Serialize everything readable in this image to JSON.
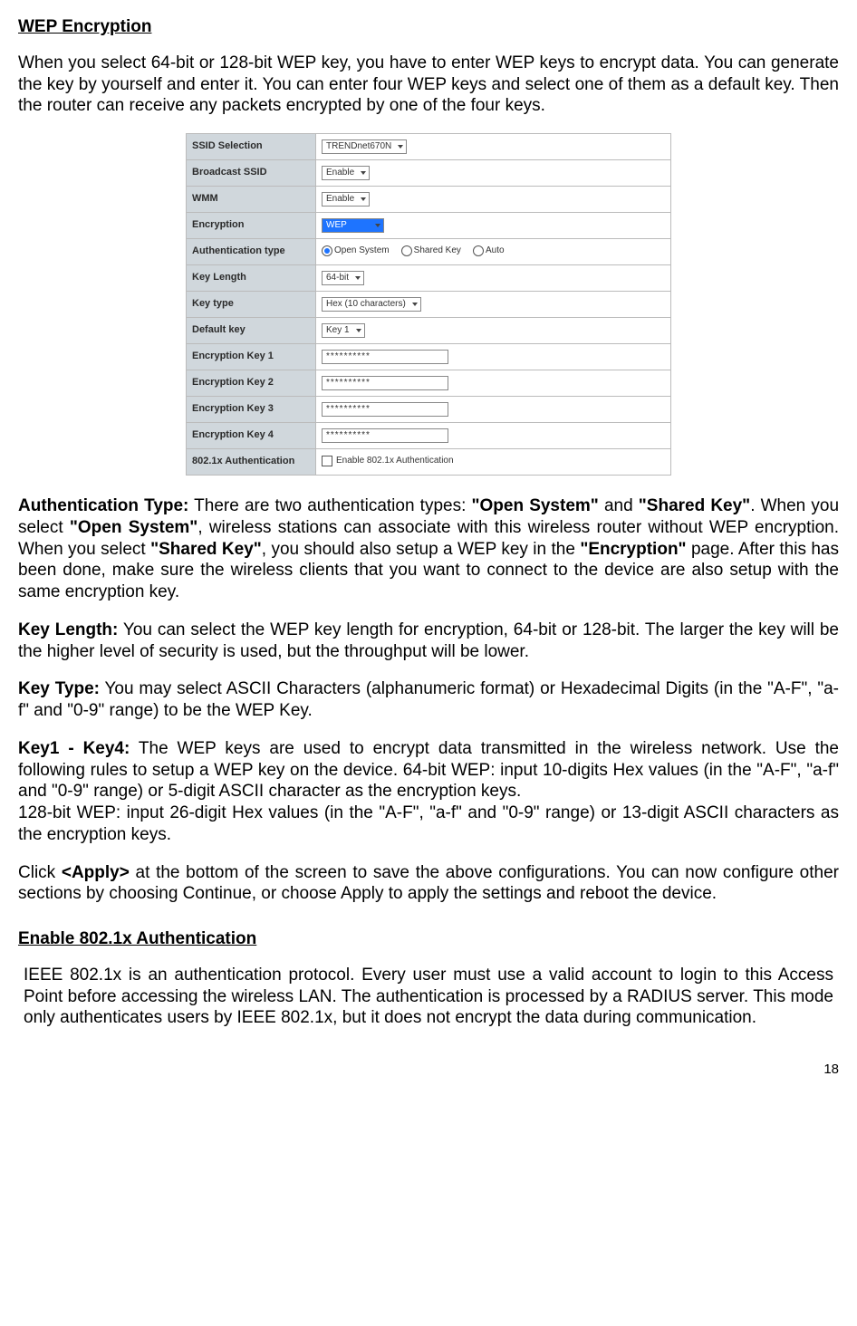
{
  "title1": "WEP Encryption",
  "intro": "When you select 64-bit or 128-bit WEP key, you have to enter WEP keys to encrypt data. You can generate the key by yourself and enter it. You can enter four WEP keys and select one of them as a default key. Then the router can receive any packets encrypted by one of the four keys.",
  "table": {
    "rows": [
      {
        "label": "SSID Selection",
        "type": "select",
        "value": "TRENDnet670N"
      },
      {
        "label": "Broadcast SSID",
        "type": "select",
        "value": "Enable"
      },
      {
        "label": "WMM",
        "type": "select",
        "value": "Enable"
      },
      {
        "label": "Encryption",
        "type": "select-highlight",
        "value": "WEP"
      },
      {
        "label": "Authentication type",
        "type": "radios",
        "options": [
          "Open System",
          "Shared Key",
          "Auto"
        ],
        "checked": 0
      },
      {
        "label": "Key Length",
        "type": "select",
        "value": "64-bit"
      },
      {
        "label": "Key type",
        "type": "select",
        "value": "Hex (10 characters)"
      },
      {
        "label": "Default key",
        "type": "select",
        "value": "Key 1"
      },
      {
        "label": "Encryption Key 1",
        "type": "text",
        "value": "**********"
      },
      {
        "label": "Encryption Key 2",
        "type": "text",
        "value": "**********"
      },
      {
        "label": "Encryption Key 3",
        "type": "text",
        "value": "**********"
      },
      {
        "label": "Encryption Key 4",
        "type": "text",
        "value": "**********"
      },
      {
        "label": "802.1x Authentication",
        "type": "checkbox",
        "value": "Enable 802.1x Authentication"
      }
    ]
  },
  "auth_type_label": "Authentication Type:",
  "auth_type_text1": " There are two authentication types: ",
  "auth_type_b1": "\"Open System\"",
  "auth_type_text2": " and ",
  "auth_type_b2": "\"Shared Key\"",
  "auth_type_text3": ". When you select ",
  "auth_type_b3": "\"Open System\"",
  "auth_type_text4": ", wireless stations can associate with this wireless router without WEP encryption. When you select ",
  "auth_type_b4": "\"Shared Key\"",
  "auth_type_text5": ", you should also setup a WEP key in the ",
  "auth_type_b5": "\"Encryption\"",
  "auth_type_text6": " page. After this has been done, make sure the wireless clients that you want to connect to the device are also setup with the same encryption key.",
  "key_length_label": "Key Length:",
  "key_length_text": " You can select the WEP key length for encryption, 64-bit or 128-bit. The larger the key will be the higher level of security is used, but the throughput will be lower.",
  "key_type_label": "Key Type:",
  "key_type_text": " You may select ASCII Characters (alphanumeric format) or Hexadecimal Digits (in the \"A-F\", \"a-f\" and \"0-9\" range) to be the WEP Key.",
  "key14_label": "Key1 - Key4:",
  "key14_text": " The WEP keys are used to encrypt data transmitted in the wireless network. Use the following rules to setup a WEP key on the device. 64-bit WEP: input 10-digits Hex values (in the \"A-F\", \"a-f\" and \"0-9\" range) or 5-digit ASCII character as the encryption keys.",
  "key128_text": "128-bit WEP: input 26-digit Hex values (in the \"A-F\", \"a-f\" and \"0-9\" range) or 13-digit ASCII characters as the encryption keys.",
  "apply_text1": "Click ",
  "apply_b": "<Apply>",
  "apply_text2": " at the bottom of the screen to save the above configurations. You can now configure other sections by choosing Continue, or choose Apply to apply the settings and reboot the device.",
  "title2": "Enable 802.1x Authentication",
  "ieee_text": "IEEE 802.1x is an authentication protocol. Every user must use a valid account to login to this Access Point before accessing the wireless LAN. The authentication is processed by a RADIUS server. This mode only authenticates users by IEEE 802.1x, but it does not encrypt the data during communication.",
  "page_number": "18"
}
